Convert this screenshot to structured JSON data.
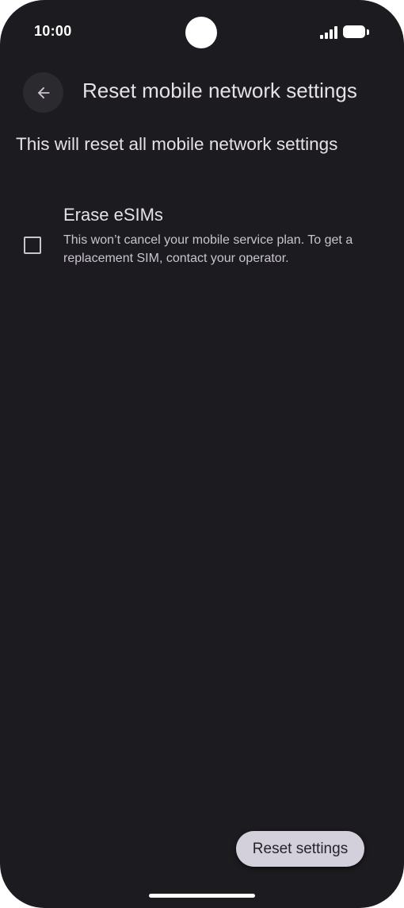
{
  "status_bar": {
    "time": "10:00",
    "icons": [
      "camera-cutout",
      "signal-icon",
      "battery-icon"
    ]
  },
  "header": {
    "back_icon": "arrow-left-icon",
    "title": "Reset mobile network settings"
  },
  "main": {
    "description": "This will reset all mobile network settings",
    "options": [
      {
        "title": "Erase eSIMs",
        "summary": "This won’t cancel your mobile service plan. To get a replacement SIM, contact your operator.",
        "checked": false
      }
    ]
  },
  "footer": {
    "reset_button_label": "Reset settings"
  },
  "colors": {
    "background": "#1c1b1f",
    "text_primary": "#e6e1e5",
    "text_secondary": "#cac4d0",
    "button_background": "#d3d0dc"
  }
}
